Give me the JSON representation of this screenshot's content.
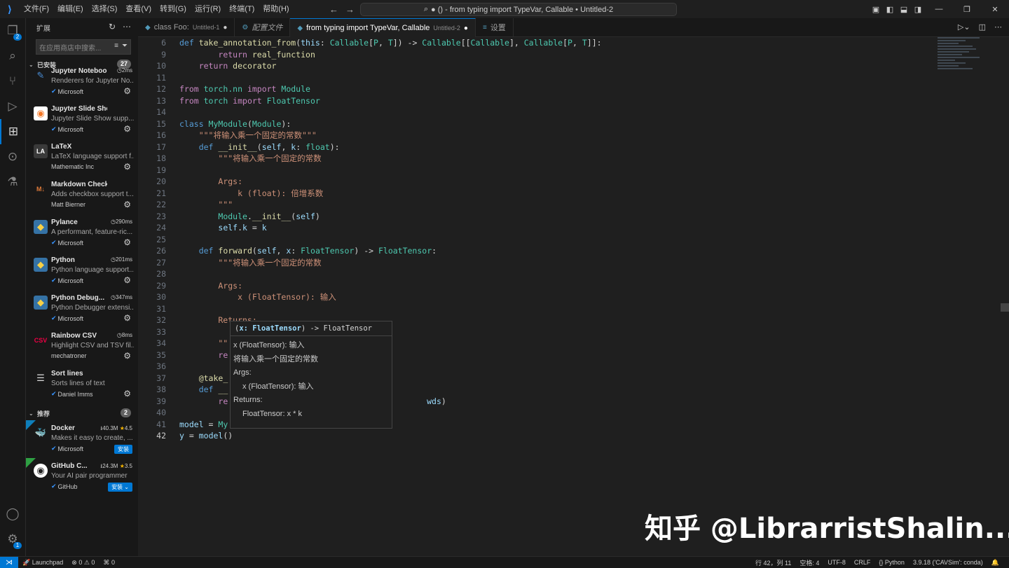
{
  "titlebar": {
    "menus": [
      "文件(F)",
      "编辑(E)",
      "选择(S)",
      "查看(V)",
      "转到(G)",
      "运行(R)",
      "终端(T)",
      "帮助(H)"
    ],
    "command_center": "● () - from typing import TypeVar, Callable • Untitled-2"
  },
  "activity_bar": {
    "explorer_badge": "2",
    "account_badge": "1"
  },
  "sidebar": {
    "title": "扩展",
    "search_placeholder": "在应用商店中搜索...",
    "installed_label": "已安装",
    "installed_count": "27",
    "installed": [
      {
        "name": "Jupyter Noteboo...",
        "meta": "2ms",
        "desc": "Renderers for Jupyter No...",
        "publisher": "Microsoft",
        "verified": true,
        "icon": "jupyter-renderers-icon"
      },
      {
        "name": "Jupyter Slide Show",
        "meta": "",
        "desc": "Jupyter Slide Show supp...",
        "publisher": "Microsoft",
        "verified": true,
        "icon": "jupyter-slideshow-icon"
      },
      {
        "name": "LaTeX",
        "meta": "",
        "desc": "LaTeX language support f...",
        "publisher": "Mathematic Inc",
        "verified": false,
        "icon": "latex-icon"
      },
      {
        "name": "Markdown Checkboxes",
        "meta": "",
        "desc": "Adds checkbox support t...",
        "publisher": "Matt Bierner",
        "verified": false,
        "icon": "markdown-icon"
      },
      {
        "name": "Pylance",
        "meta": "290ms",
        "desc": "A performant, feature-ric...",
        "publisher": "Microsoft",
        "verified": true,
        "icon": "python-icon"
      },
      {
        "name": "Python",
        "meta": "201ms",
        "desc": "Python language support...",
        "publisher": "Microsoft",
        "verified": true,
        "icon": "python-icon"
      },
      {
        "name": "Python Debug...",
        "meta": "347ms",
        "desc": "Python Debugger extensi...",
        "publisher": "Microsoft",
        "verified": true,
        "icon": "python-icon"
      },
      {
        "name": "Rainbow CSV",
        "meta": "8ms",
        "desc": "Highlight CSV and TSV fil...",
        "publisher": "mechatroner",
        "verified": false,
        "icon": "csv-icon"
      },
      {
        "name": "Sort lines",
        "meta": "",
        "desc": "Sorts lines of text",
        "publisher": "Daniel Imms",
        "verified": true,
        "icon": "sort-icon"
      }
    ],
    "recommended_label": "推荐",
    "recommended_count": "2",
    "recommended": [
      {
        "name": "Docker",
        "downloads": "40.3M",
        "rating": "4.5",
        "desc": "Makes it easy to create, ...",
        "publisher": "Microsoft",
        "install": "安装",
        "icon": "docker-icon"
      },
      {
        "name": "GitHub C...",
        "downloads": "24.3M",
        "rating": "3.5",
        "desc": "Your AI pair programmer",
        "publisher": "GitHub",
        "install": "安装",
        "icon": "github-icon"
      }
    ]
  },
  "tabs": [
    {
      "label": "class Foo:",
      "sub": "Untitled-1",
      "active": false
    },
    {
      "label": "配置文件",
      "sub": "",
      "active": false
    },
    {
      "label": "from typing import TypeVar, Callable",
      "sub": "Untitled-2",
      "active": true
    },
    {
      "label": "设置",
      "sub": "",
      "active": false
    }
  ],
  "code_lines": [
    {
      "n": "6",
      "tokens": [
        [
          "kw",
          "def "
        ],
        [
          "fn",
          "take_annotation_from"
        ],
        [
          "txt",
          "("
        ],
        [
          "var",
          "this"
        ],
        [
          "txt",
          ": "
        ],
        [
          "cls",
          "Callable"
        ],
        [
          "txt",
          "["
        ],
        [
          "cls",
          "P"
        ],
        [
          "txt",
          ", "
        ],
        [
          "cls",
          "T"
        ],
        [
          "txt",
          "]) -> "
        ],
        [
          "cls",
          "Callable"
        ],
        [
          "txt",
          "[["
        ],
        [
          "cls",
          "Callable"
        ],
        [
          "txt",
          "], "
        ],
        [
          "cls",
          "Callable"
        ],
        [
          "txt",
          "["
        ],
        [
          "cls",
          "P"
        ],
        [
          "txt",
          ", "
        ],
        [
          "cls",
          "T"
        ],
        [
          "txt",
          "]]:"
        ]
      ]
    },
    {
      "n": "9",
      "tokens": [
        [
          "txt",
          "        "
        ],
        [
          "ctrl",
          "return "
        ],
        [
          "fn",
          "real_function"
        ]
      ]
    },
    {
      "n": "10",
      "tokens": [
        [
          "txt",
          "    "
        ],
        [
          "ctrl",
          "return "
        ],
        [
          "fn",
          "decorator"
        ]
      ]
    },
    {
      "n": "11",
      "tokens": []
    },
    {
      "n": "12",
      "tokens": [
        [
          "ctrl",
          "from "
        ],
        [
          "cls",
          "torch.nn"
        ],
        [
          "ctrl",
          " import "
        ],
        [
          "cls",
          "Module"
        ]
      ]
    },
    {
      "n": "13",
      "tokens": [
        [
          "ctrl",
          "from "
        ],
        [
          "cls",
          "torch"
        ],
        [
          "ctrl",
          " import "
        ],
        [
          "cls",
          "FloatTensor"
        ]
      ]
    },
    {
      "n": "14",
      "tokens": []
    },
    {
      "n": "15",
      "tokens": [
        [
          "kw",
          "class "
        ],
        [
          "cls",
          "MyModule"
        ],
        [
          "txt",
          "("
        ],
        [
          "cls",
          "Module"
        ],
        [
          "txt",
          "):"
        ]
      ]
    },
    {
      "n": "16",
      "tokens": [
        [
          "txt",
          "    "
        ],
        [
          "str",
          "\"\"\"将输入乘一个固定的常数\"\"\""
        ]
      ]
    },
    {
      "n": "17",
      "tokens": [
        [
          "txt",
          "    "
        ],
        [
          "kw",
          "def "
        ],
        [
          "fn",
          "__init__"
        ],
        [
          "txt",
          "("
        ],
        [
          "var",
          "self"
        ],
        [
          "txt",
          ", "
        ],
        [
          "var",
          "k"
        ],
        [
          "txt",
          ": "
        ],
        [
          "cls",
          "float"
        ],
        [
          "txt",
          "):"
        ]
      ]
    },
    {
      "n": "18",
      "tokens": [
        [
          "txt",
          "        "
        ],
        [
          "str",
          "\"\"\"将输入乘一个固定的常数"
        ]
      ]
    },
    {
      "n": "19",
      "tokens": []
    },
    {
      "n": "20",
      "tokens": [
        [
          "str",
          "        Args:"
        ]
      ]
    },
    {
      "n": "21",
      "tokens": [
        [
          "str",
          "            k (float): 倍增系数"
        ]
      ]
    },
    {
      "n": "22",
      "tokens": [
        [
          "str",
          "        \"\"\""
        ]
      ]
    },
    {
      "n": "23",
      "tokens": [
        [
          "txt",
          "        "
        ],
        [
          "cls",
          "Module"
        ],
        [
          "txt",
          "."
        ],
        [
          "fn",
          "__init__"
        ],
        [
          "txt",
          "("
        ],
        [
          "var",
          "self"
        ],
        [
          "txt",
          ")"
        ]
      ]
    },
    {
      "n": "24",
      "tokens": [
        [
          "txt",
          "        "
        ],
        [
          "var",
          "self"
        ],
        [
          "txt",
          "."
        ],
        [
          "var",
          "k"
        ],
        [
          "txt",
          " = "
        ],
        [
          "var",
          "k"
        ]
      ]
    },
    {
      "n": "25",
      "tokens": []
    },
    {
      "n": "26",
      "tokens": [
        [
          "txt",
          "    "
        ],
        [
          "kw",
          "def "
        ],
        [
          "fn",
          "forward"
        ],
        [
          "txt",
          "("
        ],
        [
          "var",
          "self"
        ],
        [
          "txt",
          ", "
        ],
        [
          "var",
          "x"
        ],
        [
          "txt",
          ": "
        ],
        [
          "cls",
          "FloatTensor"
        ],
        [
          "txt",
          ") -> "
        ],
        [
          "cls",
          "FloatTensor"
        ],
        [
          "txt",
          ":"
        ]
      ]
    },
    {
      "n": "27",
      "tokens": [
        [
          "txt",
          "        "
        ],
        [
          "str",
          "\"\"\"将输入乘一个固定的常数"
        ]
      ]
    },
    {
      "n": "28",
      "tokens": []
    },
    {
      "n": "29",
      "tokens": [
        [
          "str",
          "        Args:"
        ]
      ]
    },
    {
      "n": "30",
      "tokens": [
        [
          "str",
          "            x (FloatTensor): 输入"
        ]
      ]
    },
    {
      "n": "31",
      "tokens": []
    },
    {
      "n": "32",
      "tokens": [
        [
          "str",
          "        Returns:"
        ]
      ]
    },
    {
      "n": "33",
      "tokens": []
    },
    {
      "n": "34",
      "tokens": [
        [
          "str",
          "        \"\""
        ]
      ]
    },
    {
      "n": "35",
      "tokens": [
        [
          "txt",
          "        "
        ],
        [
          "ctrl",
          "re"
        ]
      ]
    },
    {
      "n": "36",
      "tokens": []
    },
    {
      "n": "37",
      "tokens": [
        [
          "txt",
          "    "
        ],
        [
          "fn",
          "@take_"
        ]
      ]
    },
    {
      "n": "38",
      "tokens": [
        [
          "txt",
          "    "
        ],
        [
          "kw",
          "def "
        ],
        [
          "fn",
          "__"
        ]
      ]
    },
    {
      "n": "39",
      "tokens": [
        [
          "txt",
          "        "
        ],
        [
          "ctrl",
          "re"
        ],
        [
          "txt",
          "                                         "
        ],
        [
          "var",
          "wds"
        ],
        [
          "txt",
          ")"
        ]
      ]
    },
    {
      "n": "40",
      "tokens": []
    },
    {
      "n": "41",
      "tokens": [
        [
          "var",
          "model"
        ],
        [
          "txt",
          " = "
        ],
        [
          "cls",
          "My"
        ]
      ]
    },
    {
      "n": "42",
      "tokens": [
        [
          "var",
          "y"
        ],
        [
          "txt",
          " = "
        ],
        [
          "var",
          "model"
        ],
        [
          "txt",
          "()"
        ]
      ]
    }
  ],
  "hover": {
    "signature_param": "x: FloatTensor",
    "signature_rest": ") -> FloatTensor",
    "doc_lines": [
      "x (FloatTensor): 输入",
      "将输入乘一个固定的常数",
      "Args:",
      "x (FloatTensor): 输入",
      "Returns:",
      "FloatTensor: x * k"
    ]
  },
  "watermark": "知乎 @LibrarristShalin...",
  "status": {
    "launchpad": "Launchpad",
    "errors": "0",
    "warnings": "0",
    "ports": "0",
    "cursor": "行 42，列 11",
    "indent": "空格: 4",
    "encoding": "UTF-8",
    "eol": "CRLF",
    "language": "Python",
    "interpreter": "3.9.18 ('CAVSim': conda)"
  },
  "colors": {
    "accent": "#0078d4",
    "keyword": "#569cd6",
    "function": "#dcdcaa",
    "class": "#4ec9b0",
    "string": "#ce9178",
    "variable": "#9cdcfe",
    "control": "#c586c0"
  }
}
